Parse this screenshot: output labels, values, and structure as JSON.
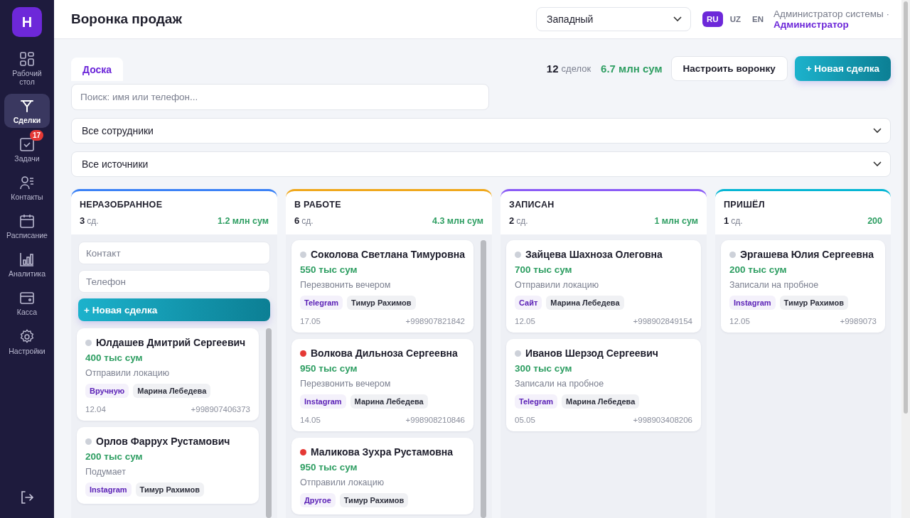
{
  "sidebar": {
    "logo": "Н",
    "items": [
      {
        "label": "Рабочий стол",
        "selected": false
      },
      {
        "label": "Сделки",
        "selected": true
      },
      {
        "label": "Задачи",
        "selected": false,
        "badge": "17"
      },
      {
        "label": "Контакты",
        "selected": false
      },
      {
        "label": "Расписание",
        "selected": false
      },
      {
        "label": "Аналитика",
        "selected": false
      },
      {
        "label": "Касса",
        "selected": false
      },
      {
        "label": "Настройки",
        "selected": false
      }
    ]
  },
  "header": {
    "title": "Воронка продаж",
    "branch": "Западный",
    "languages": [
      {
        "label": "RU",
        "selected": true
      },
      {
        "label": "UZ",
        "selected": false
      },
      {
        "label": "EN",
        "selected": false
      }
    ],
    "user_name": "Администратор системы ·",
    "user_role": "Администратор"
  },
  "tabs": [
    {
      "label": "Доска",
      "selected": true
    }
  ],
  "summary": {
    "count": "12",
    "count_unit": "сделок",
    "total": "6.7 млн сум"
  },
  "buttons": {
    "configure": "Настроить воронку",
    "new_deal": "+ Новая сделка"
  },
  "search": {
    "placeholder": "Поиск: имя или телефон..."
  },
  "filters": [
    {
      "value": "Все сотрудники"
    },
    {
      "value": "Все источники"
    }
  ],
  "columns": [
    {
      "title": "НЕРАЗОБРАННОЕ",
      "count": "3",
      "count_unit": "сд.",
      "total": "1.2 млн сум",
      "color": "#3b82f6",
      "scrollable": true,
      "quick_add": {
        "contact_placeholder": "Контакт",
        "phone_placeholder": "Телефон",
        "button": "+ Новая сделка"
      },
      "deals": [
        {
          "name": "Юлдашев Дмитрий Сергеевич",
          "color": "#cdd1d9",
          "amount": "400 тыс сум",
          "note": "Отправили локацию",
          "source": "Вручную",
          "manager": "Марина Лебедева",
          "date": "12.04",
          "phone": "+998907406373"
        },
        {
          "name": "Орлов Фаррух Рустамович",
          "color": "#cdd1d9",
          "amount": "200 тыс сум",
          "note": "Подумает",
          "source": "Instagram",
          "manager": "Тимур Рахимов"
        }
      ]
    },
    {
      "title": "В РАБОТЕ",
      "count": "6",
      "count_unit": "сд.",
      "total": "4.3 млн сум",
      "color": "#f0a81c",
      "scrollable": true,
      "deals": [
        {
          "name": "Соколова Светлана Тимуровна",
          "color": "#cdd1d9",
          "amount": "550 тыс сум",
          "note": "Перезвонить вечером",
          "source": "Telegram",
          "manager": "Тимур Рахимов",
          "date": "17.05",
          "phone": "+998907821842"
        },
        {
          "name": "Волкова Дильноза Сергеевна",
          "color": "#e53935",
          "amount": "950 тыс сум",
          "note": "Перезвонить вечером",
          "source": "Instagram",
          "manager": "Марина Лебедева",
          "date": "14.05",
          "phone": "+998908210846"
        },
        {
          "name": "Маликова Зухра Рустамовна",
          "color": "#e53935",
          "amount": "950 тыс сум",
          "note": "Отправили локацию",
          "source": "Другое",
          "manager": "Тимур Рахимов"
        }
      ]
    },
    {
      "title": "ЗАПИСАН",
      "count": "2",
      "count_unit": "сд.",
      "total": "1 млн сум",
      "color": "#8b5cf6",
      "scrollable": false,
      "deals": [
        {
          "name": "Зайцева Шахноза Олеговна",
          "color": "#cdd1d9",
          "amount": "700 тыс сум",
          "note": "Отправили локацию",
          "source": "Сайт",
          "manager": "Марина Лебедева",
          "date": "12.05",
          "phone": "+998902849154"
        },
        {
          "name": "Иванов Шерзод Сергеевич",
          "color": "#cdd1d9",
          "amount": "300 тыс сум",
          "note": "Записали на пробное",
          "source": "Telegram",
          "manager": "Марина Лебедева",
          "date": "05.05",
          "phone": "+998903408206"
        }
      ]
    },
    {
      "title": "ПРИШЁЛ",
      "count": "1",
      "count_unit": "сд.",
      "total": "200",
      "color": "#06b6d4",
      "scrollable": false,
      "deals": [
        {
          "name": "Эргашева Юлия Сергеевна",
          "color": "#cdd1d9",
          "amount": "200 тыс сум",
          "note": "Записали на пробное",
          "source": "Instagram",
          "manager": "Тимур Рахимов",
          "date": "12.05",
          "phone": "+9989073"
        }
      ]
    }
  ]
}
